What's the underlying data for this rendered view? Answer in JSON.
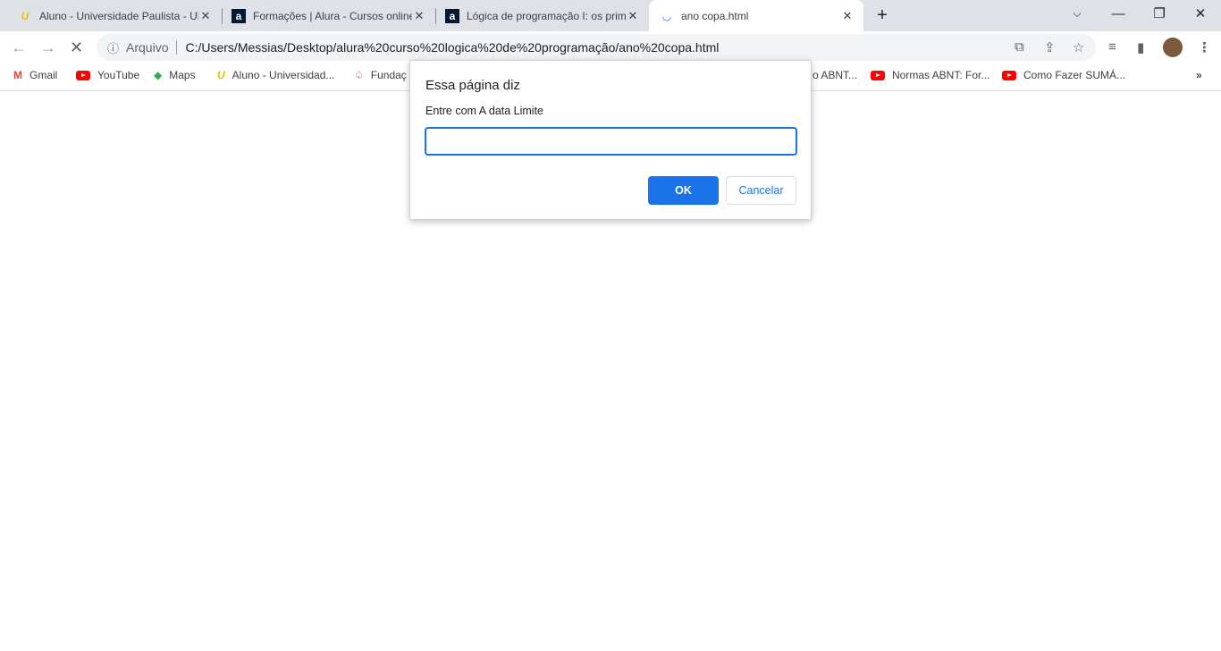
{
  "tabs": [
    {
      "title": "Aluno - Universidade Paulista - UNIP",
      "icon": "unip-icon"
    },
    {
      "title": "Formações | Alura - Cursos online de tecnologia",
      "icon": "alura-icon"
    },
    {
      "title": "Lógica de programação I: os primeiros",
      "icon": "alura-icon"
    },
    {
      "title": "ano copa.html",
      "icon": "loading-spinner-icon",
      "active": true
    }
  ],
  "toolbar": {
    "security_label": "Arquivo",
    "url": "C:/Users/Messias/Desktop/alura%20curso%20logica%20de%20programação/ano%20copa.html"
  },
  "bookmarks": [
    {
      "label": "Gmail"
    },
    {
      "label": "YouTube"
    },
    {
      "label": "Maps"
    },
    {
      "label": "Aluno - Universidad..."
    },
    {
      "label": "Fundaç"
    },
    {
      "label": "o ABNT..."
    },
    {
      "label": "Normas ABNT: For..."
    },
    {
      "label": "Como Fazer SUMÁ..."
    }
  ],
  "dialog": {
    "title": "Essa página diz",
    "message": "Entre com A data Limite",
    "input_value": "",
    "ok_label": "OK",
    "cancel_label": "Cancelar"
  },
  "colors": {
    "accent": "#1a73e8",
    "tabbar": "#dee1e6"
  }
}
